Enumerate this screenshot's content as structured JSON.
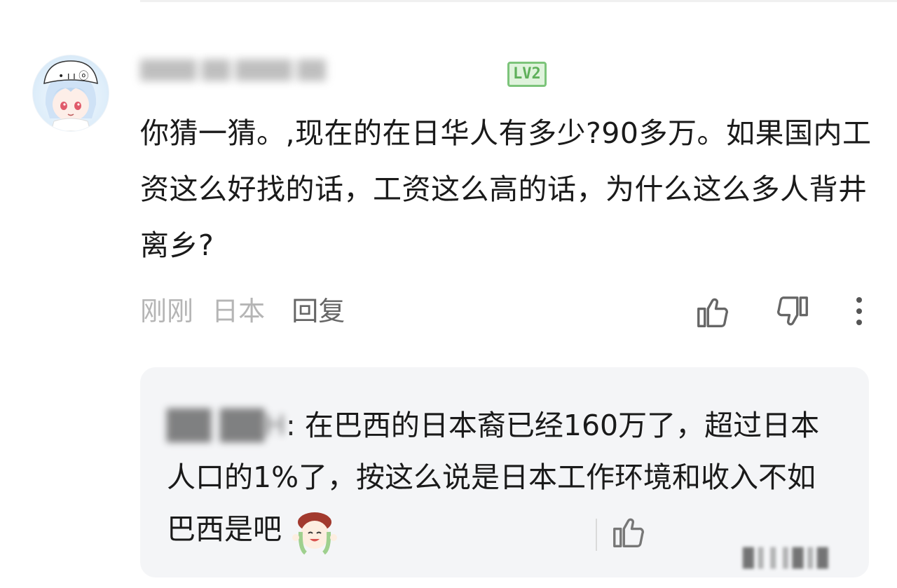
{
  "comment": {
    "username": "████ ██ ████ ██",
    "level": "LV2",
    "text": "你猜一猜。,现在的在日华人有多少?90多万。如果国内工资这么好找的话，工资这么高的话，为什么这么多人背井离乡?",
    "time": "刚刚",
    "location": "日本",
    "reply_label": "回复"
  },
  "reply": {
    "author": "██ ██H",
    "text": "在巴西的日本裔已经160万了，超过日本人口的1%了，按这么说是日本工作环境和收入不如巴西是吧"
  },
  "icons": {
    "like": "thumbs-up-icon",
    "dislike": "thumbs-down-icon",
    "more": "more-vertical-icon",
    "reply_like": "thumbs-up-icon"
  },
  "colors": {
    "level_badge": "#7cc47a",
    "reply_background": "#f4f5f7",
    "meta_text": "#b5b5b5"
  },
  "watermark": "█║║║█║█"
}
